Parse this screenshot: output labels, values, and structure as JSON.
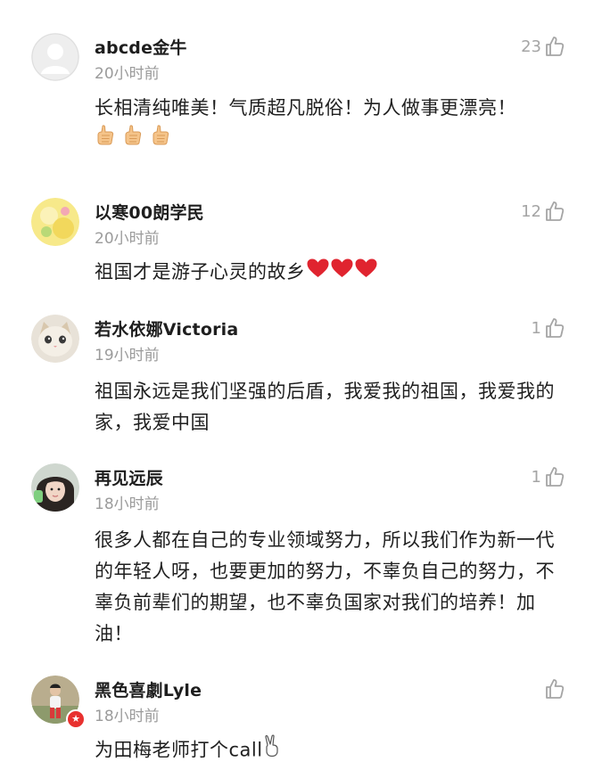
{
  "comments": [
    {
      "name": "abcde金牛",
      "time": "20小时前",
      "likes": "23",
      "text": "长相清纯唯美！气质超凡脱俗！为人做事更漂亮！",
      "emojis": [
        "thumbs-up",
        "thumbs-up",
        "thumbs-up"
      ],
      "avatar": "default-avatar"
    },
    {
      "name": "以寒00朗学民",
      "time": "20小时前",
      "likes": "12",
      "text": "祖国才是游子心灵的故乡",
      "emojis": [
        "red-heart",
        "red-heart",
        "red-heart"
      ],
      "avatar": "yellow-avatar"
    },
    {
      "name": "若水依娜Victoria",
      "time": "19小时前",
      "likes": "1",
      "text": "祖国永远是我们坚强的后盾，我爱我的祖国，我爱我的家，我爱中国",
      "avatar": "cat-avatar"
    },
    {
      "name": "再见远辰",
      "time": "18小时前",
      "likes": "1",
      "text": "很多人都在自己的专业领域努力，所以我们作为新一代的年轻人呀，也要更加的努力，不辜负自己的努力，不辜负前辈们的期望，也不辜负国家对我们的培养！加油！",
      "avatar": "girl-avatar"
    },
    {
      "name": "黑色喜劇Lyle",
      "time": "18小时前",
      "likes": "",
      "text": "为田梅老师打个call",
      "emojis": [
        "victory-hand"
      ],
      "avatar": "person-avatar",
      "verified": true
    }
  ],
  "colors": {
    "name": "#1e1e1e",
    "time": "#9b9b9b",
    "like": "#a5a5a5",
    "heart": "#e0242f",
    "badge": "#e8312f"
  }
}
